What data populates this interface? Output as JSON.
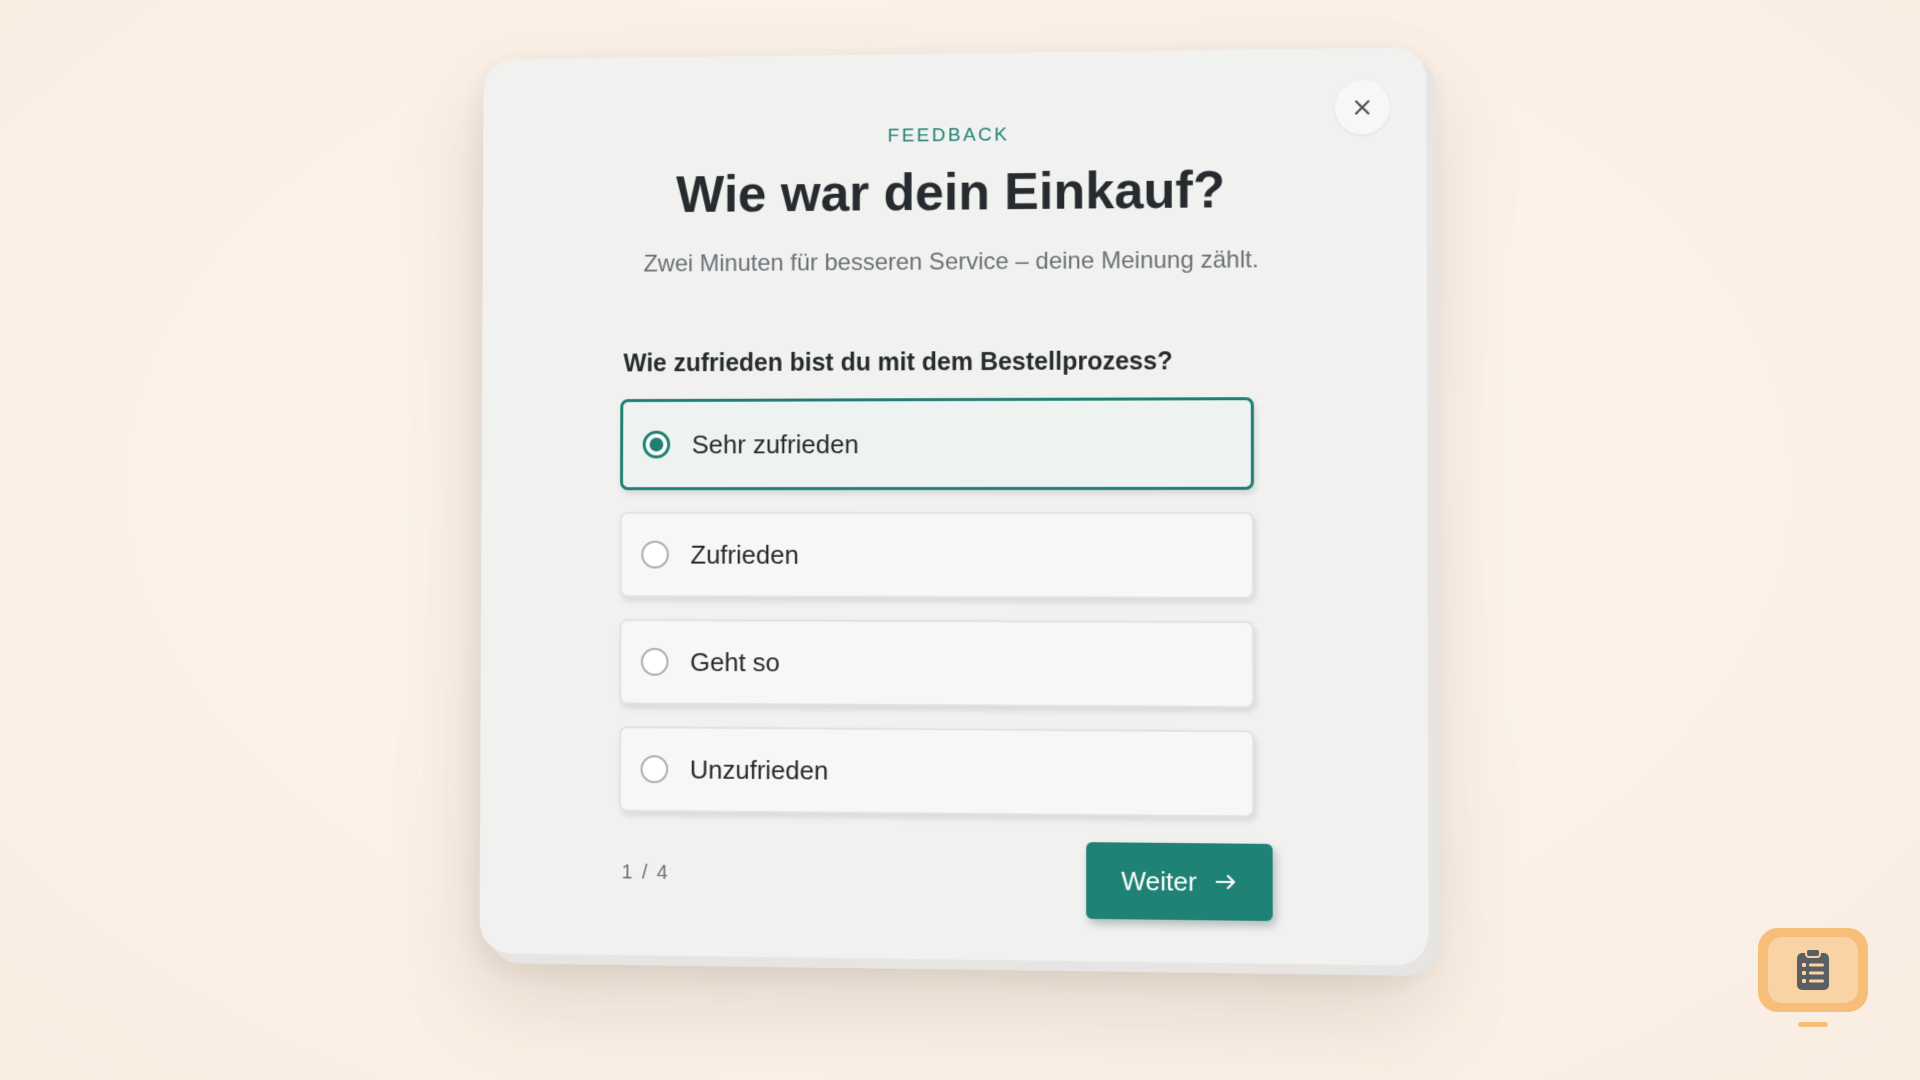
{
  "dialog": {
    "eyebrow": "FEEDBACK",
    "title": "Wie war dein Einkauf?",
    "subtitle": "Zwei Minuten für besseren Service – deine Meinung zählt.",
    "close_icon": "close-icon"
  },
  "question": {
    "text": "Wie zufrieden bist du mit dem Bestellprozess?",
    "options": [
      {
        "label": "Sehr zufrieden",
        "selected": true
      },
      {
        "label": "Zufrieden",
        "selected": false
      },
      {
        "label": "Geht so",
        "selected": false
      },
      {
        "label": "Unzufrieden",
        "selected": false
      }
    ]
  },
  "footer": {
    "pager": "1 / 4",
    "next_label": "Weiter",
    "next_icon": "arrow-right-icon"
  },
  "launcher": {
    "icon": "clipboard-checklist-icon"
  },
  "colors": {
    "accent": "#1f7f72",
    "background": "#fcf2e9",
    "card": "#f1f1f0",
    "launcher": "#f6be78"
  }
}
